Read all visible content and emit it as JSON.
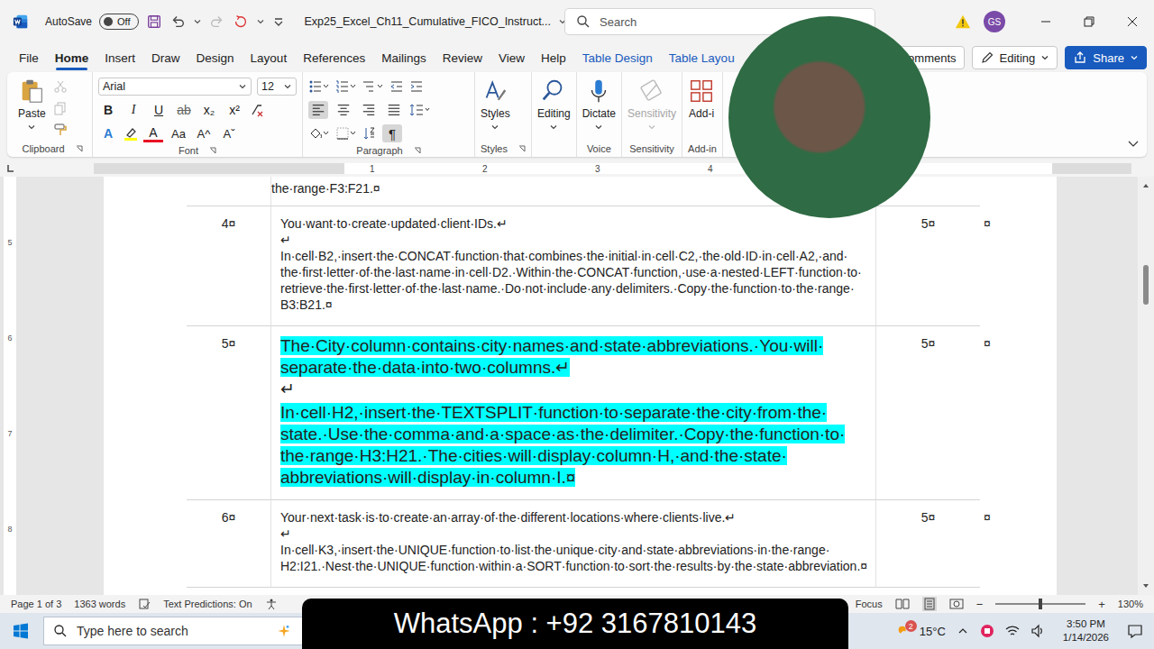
{
  "window": {
    "title": "Exp25_Excel_Ch11_Cumulative_FICO_Instruct...",
    "autosave": {
      "label": "AutoSave",
      "state": "Off",
      "on": false
    },
    "search": {
      "placeholder": "Search"
    },
    "avatar": "GS"
  },
  "tabs": [
    {
      "label": "File",
      "selected": false,
      "contextual": false
    },
    {
      "label": "Home",
      "selected": true,
      "contextual": false
    },
    {
      "label": "Insert",
      "selected": false,
      "contextual": false
    },
    {
      "label": "Draw",
      "selected": false,
      "contextual": false
    },
    {
      "label": "Design",
      "selected": false,
      "contextual": false
    },
    {
      "label": "Layout",
      "selected": false,
      "contextual": false
    },
    {
      "label": "References",
      "selected": false,
      "contextual": false
    },
    {
      "label": "Mailings",
      "selected": false,
      "contextual": false
    },
    {
      "label": "Review",
      "selected": false,
      "contextual": false
    },
    {
      "label": "View",
      "selected": false,
      "contextual": false
    },
    {
      "label": "Help",
      "selected": false,
      "contextual": false
    },
    {
      "label": "Table Design",
      "selected": false,
      "contextual": true
    },
    {
      "label": "Table Layou",
      "selected": false,
      "contextual": true
    }
  ],
  "tab_actions": {
    "comments": "Comments",
    "editing": "Editing",
    "share": "Share"
  },
  "ribbon": {
    "clipboard": {
      "paste": "Paste",
      "label": "Clipboard"
    },
    "font": {
      "name": "Arial",
      "size": "12",
      "format_buttons": [
        "B",
        "I",
        "U",
        "ab",
        "x₂",
        "x²"
      ],
      "effect_buttons": [
        {
          "glyph": "A",
          "kind": "effects"
        },
        {
          "glyph": "A",
          "kind": "color"
        },
        {
          "glyph": "Aa",
          "kind": "case"
        },
        {
          "glyph": "A^",
          "kind": "size"
        },
        {
          "glyph": "Aˇ",
          "kind": "size"
        }
      ],
      "label": "Font"
    },
    "paragraph": {
      "label": "Paragraph",
      "alignment": [
        {
          "kind": "left",
          "selected": true
        },
        {
          "kind": "center",
          "selected": false
        },
        {
          "kind": "right",
          "selected": false
        },
        {
          "kind": "justify",
          "selected": false
        }
      ],
      "marks": {
        "glyph": "¶",
        "selected": true
      }
    },
    "styles": {
      "button": "Styles",
      "label": "Styles"
    },
    "editing": {
      "button": "Editing"
    },
    "voice": {
      "button": "Dictate",
      "label": "Voice"
    },
    "sensitivity": {
      "button": "Sensitivity",
      "label": "Sensitivity",
      "disabled": true
    },
    "addins": {
      "button": "Add-i",
      "label": "Add-in"
    }
  },
  "ruler": {
    "horizontal": [
      "1",
      "2",
      "3",
      "4"
    ],
    "vertical": [
      "5",
      "6",
      "7",
      "8"
    ]
  },
  "document": {
    "cut_off_top": "the·range·F3:F21.¤",
    "rows": [
      {
        "number": "4¤",
        "points": "5¤",
        "end": "¤",
        "highlighted": false,
        "lines": [
          {
            "text": "You·want·to·create·updated·client·IDs.↵",
            "highlighted": false
          },
          {
            "text": "↵",
            "highlighted": false
          },
          {
            "text": "In·cell·B2,·insert·the·CONCAT·function·that·combines·the·initial·in·cell·C2,·the·old·ID·in·cell·A2,·and·the·first·letter·of·the·last·name·in·cell·D2.·Within·the·CONCAT·function,·use·a·nested·LEFT·function·to·retrieve·the·first·letter·of·the·last·name.·Do·not·include·any·delimiters.·Copy·the·function·to·the·range·B3:B21.¤",
            "highlighted": false
          }
        ]
      },
      {
        "number": "5¤",
        "points": "5¤",
        "end": "¤",
        "highlighted": true,
        "lines": [
          {
            "text": "The·City·column·contains·city·names·and·state·abbreviations.·You·will·separate·the·data·into·two·columns.↵",
            "highlighted": true
          },
          {
            "text": "↵",
            "highlighted": false
          },
          {
            "text": "In·cell·H2,·insert·the·TEXTSPLIT·function·to·separate·the·city·from·the·state.·Use·the·comma·and·a·space·as·the·delimiter.·Copy·the·function·to·the·range·H3:H21.·The·cities·will·display·column·H,·and·the·state·abbreviations·will·display·in·column·I.¤",
            "highlighted": true
          }
        ]
      },
      {
        "number": "6¤",
        "points": "5¤",
        "end": "¤",
        "highlighted": false,
        "lines": [
          {
            "text": "Your·next·task·is·to·create·an·array·of·the·different·locations·where·clients·live.↵",
            "highlighted": false
          },
          {
            "text": "↵",
            "highlighted": false
          },
          {
            "text": "In·cell·K3,·insert·the·UNIQUE·function·to·list·the·unique·city·and·state·abbreviations·in·the·range·H2:I21.·Nest·the·UNIQUE·function·within·a·SORT·function·to·sort·the·results·by·the·state·abbreviation.¤",
            "highlighted": false
          }
        ]
      }
    ]
  },
  "status_bar": {
    "page": "Page 1 of 3",
    "words": "1363 words",
    "predictions": "Text Predictions: On",
    "focus": "Focus",
    "zoom": {
      "minus": "−",
      "plus": "+",
      "level": 0.5,
      "reading": "130%"
    }
  },
  "taskbar": {
    "search": "Type here to search",
    "weather": {
      "badge": "2",
      "temp": "15°C"
    },
    "time": "3:50 PM",
    "date": "1/14/2026"
  },
  "banner": {
    "text": "WhatsApp : +92 3167810143"
  }
}
